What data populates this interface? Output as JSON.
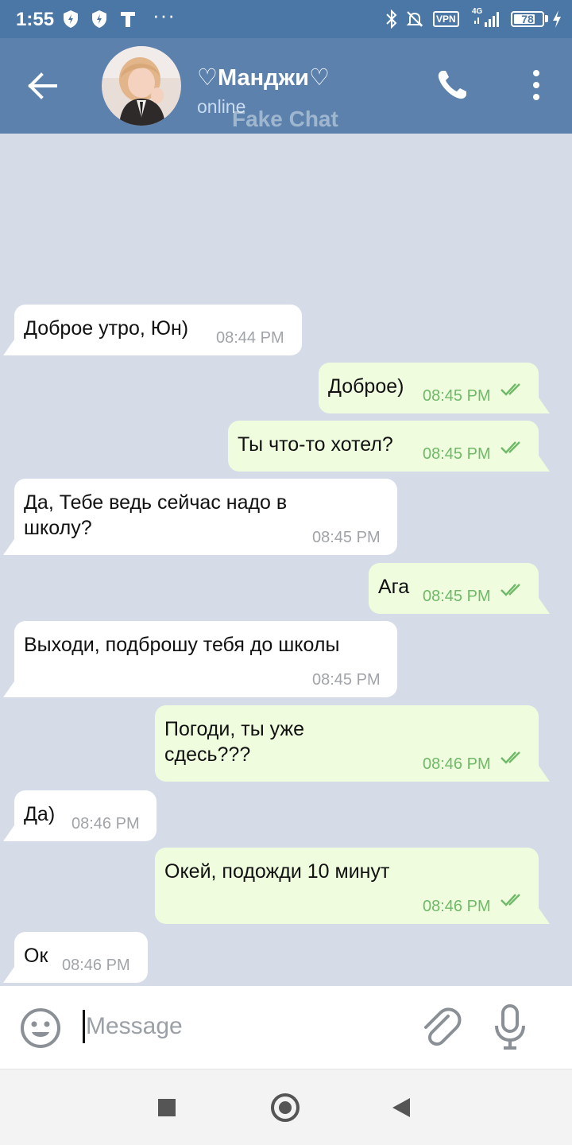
{
  "status_bar": {
    "time": "1:55",
    "dots": "···",
    "vpn": "VPN",
    "network": "4G",
    "battery": "78",
    "battery_level": 0.78
  },
  "header": {
    "contact_name": "♡Манджи♡",
    "status": "online",
    "watermark": "Fake Chat"
  },
  "messages": [
    {
      "direction": "in",
      "text": "Доброе утро, Юн)",
      "time": "08:44 PM"
    },
    {
      "direction": "out",
      "text": "Доброе)",
      "time": "08:45 PM",
      "read": true
    },
    {
      "direction": "out",
      "text": "Ты что-то хотел?",
      "time": "08:45 PM",
      "read": true
    },
    {
      "direction": "in",
      "text": "Да, Тебе ведь сейчас надо в\nшколу?",
      "time": "08:45 PM"
    },
    {
      "direction": "out",
      "text": "Ага",
      "time": "08:45 PM",
      "read": true
    },
    {
      "direction": "in",
      "text": "Выходи, подброшу тебя до школы",
      "time": "08:45 PM"
    },
    {
      "direction": "out",
      "text": "Погоди, ты уже\nсдесь???",
      "time": "08:46 PM",
      "read": true
    },
    {
      "direction": "in",
      "text": "Да)",
      "time": "08:46 PM"
    },
    {
      "direction": "out",
      "text": "Окей, подожди 10 минут",
      "time": "08:46 PM",
      "read": true
    },
    {
      "direction": "in",
      "text": "Ок",
      "time": "08:46 PM"
    }
  ],
  "input": {
    "placeholder": "Message",
    "value": ""
  },
  "colors": {
    "header": "#5b81ac",
    "status_bar": "#4a77a6",
    "chat_background": "#d6dbe8",
    "incoming_bubble": "#ffffff",
    "outgoing_bubble": "#effdde",
    "outgoing_time": "#6fb968"
  },
  "icons": [
    "back-arrow-icon",
    "phone-icon",
    "more-vert-icon",
    "emoji-icon",
    "attach-icon",
    "mic-icon",
    "double-check-icon"
  ]
}
